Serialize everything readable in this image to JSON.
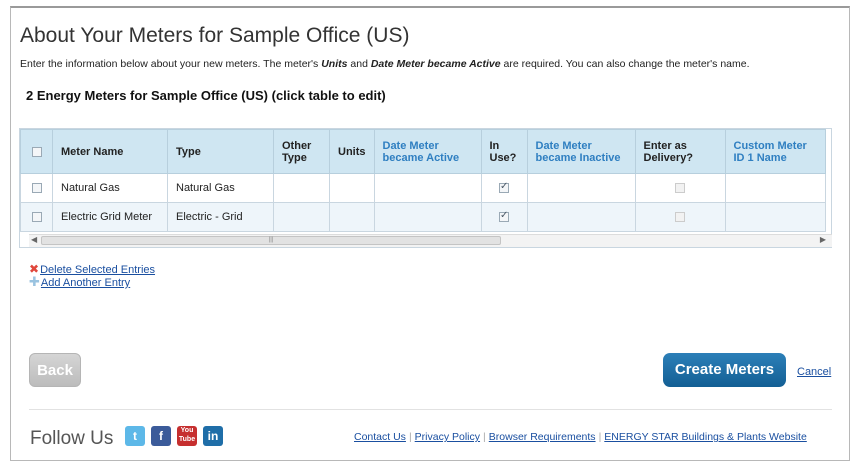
{
  "page": {
    "title": "About Your Meters for Sample Office (US)",
    "intro_before": "Enter the information below about your new meters. The meter's ",
    "intro_units": "Units",
    "intro_and": " and ",
    "intro_date": "Date Meter became Active",
    "intro_after": " are required. You can also change the meter's name.",
    "subtitle": "2 Energy Meters for Sample Office (US) (click table to edit)"
  },
  "table": {
    "headers": {
      "meter_name": "Meter Name",
      "type": "Type",
      "other_type": "Other Type",
      "units": "Units",
      "date_active": "Date Meter became Active",
      "in_use": "In Use?",
      "date_inactive": "Date Meter became Inactive",
      "enter_delivery": "Enter as Delivery?",
      "custom_id": "Custom Meter ID 1 Name"
    },
    "rows": [
      {
        "meter_name": "Natural Gas",
        "type": "Natural Gas",
        "other_type": "",
        "units": "",
        "date_active": "",
        "in_use": true,
        "date_inactive": "",
        "enter_delivery": false,
        "custom_id": ""
      },
      {
        "meter_name": "Electric Grid Meter",
        "type": "Electric - Grid",
        "other_type": "",
        "units": "",
        "date_active": "",
        "in_use": true,
        "date_inactive": "",
        "enter_delivery": false,
        "custom_id": ""
      }
    ]
  },
  "actions": {
    "delete": "Delete Selected Entries",
    "add": "Add Another Entry"
  },
  "buttons": {
    "back": "Back",
    "create": "Create Meters",
    "cancel": "Cancel"
  },
  "footer": {
    "follow": "Follow Us",
    "social_icons": [
      "twitter-icon",
      "facebook-icon",
      "youtube-icon",
      "linkedin-icon"
    ],
    "links": [
      "Contact Us",
      "Privacy Policy",
      "Browser Requirements",
      "ENERGY STAR Buildings & Plants Website"
    ]
  },
  "colors": {
    "header_bg": "#cfe6f2",
    "link_header": "#2f7fc1",
    "create_button": "#1b6fa8",
    "back_button": "#c8c8c8",
    "link": "#1a4fa0"
  }
}
